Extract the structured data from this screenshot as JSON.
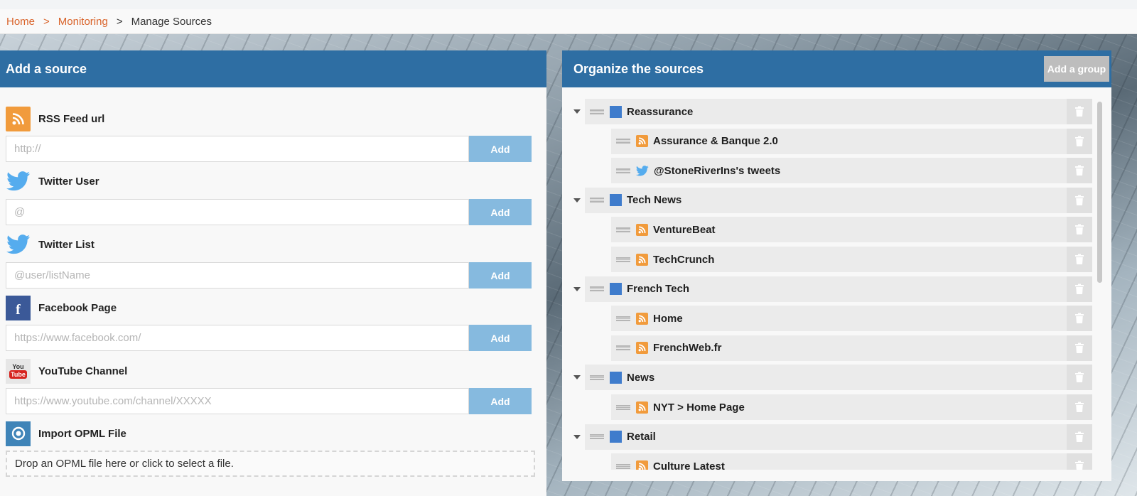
{
  "breadcrumb": {
    "home": "Home",
    "sep1": ">",
    "monitoring": "Monitoring",
    "sep2": ">",
    "current": "Manage Sources"
  },
  "add_source": {
    "title": "Add a source",
    "sources": [
      {
        "label": "RSS Feed url",
        "icon": "rss-icon",
        "placeholder": "http://",
        "button": "Add"
      },
      {
        "label": "Twitter User",
        "icon": "twitter-icon",
        "placeholder": "@",
        "button": "Add"
      },
      {
        "label": "Twitter List",
        "icon": "twitter-icon",
        "placeholder": "@user/listName",
        "button": "Add"
      },
      {
        "label": "Facebook Page",
        "icon": "facebook-icon",
        "placeholder": "https://www.facebook.com/",
        "button": "Add"
      },
      {
        "label": "YouTube Channel",
        "icon": "youtube-icon",
        "placeholder": "https://www.youtube.com/channel/XXXXX",
        "button": "Add"
      }
    ],
    "youtube_you": "You",
    "youtube_tube": "Tube",
    "facebook_letter": "f",
    "opml": {
      "label": "Import OPML File",
      "icon": "opml-icon",
      "dropzone": "Drop an OPML file here or click to select a file."
    }
  },
  "organize": {
    "title": "Organize the sources",
    "add_group": "Add a group",
    "rows": [
      {
        "type": "group",
        "label": "Reassurance"
      },
      {
        "type": "rss",
        "label": "Assurance & Banque 2.0"
      },
      {
        "type": "twitter",
        "label": "@StoneRiverIns's tweets"
      },
      {
        "type": "group",
        "label": "Tech News"
      },
      {
        "type": "rss",
        "label": "VentureBeat"
      },
      {
        "type": "rss",
        "label": "TechCrunch"
      },
      {
        "type": "group",
        "label": "French Tech"
      },
      {
        "type": "rss",
        "label": "Home"
      },
      {
        "type": "rss",
        "label": "FrenchWeb.fr"
      },
      {
        "type": "group",
        "label": "News"
      },
      {
        "type": "rss",
        "label": "NYT > Home Page"
      },
      {
        "type": "group",
        "label": "Retail"
      },
      {
        "type": "rss",
        "label": "Culture Latest"
      }
    ]
  },
  "colors": {
    "header_blue": "#2e6ea3",
    "breadcrumb_link": "#d9632a",
    "add_button": "#86badf",
    "rss_orange": "#f19b3c",
    "twitter_blue": "#55acee",
    "group_square": "#3f7ccc"
  }
}
